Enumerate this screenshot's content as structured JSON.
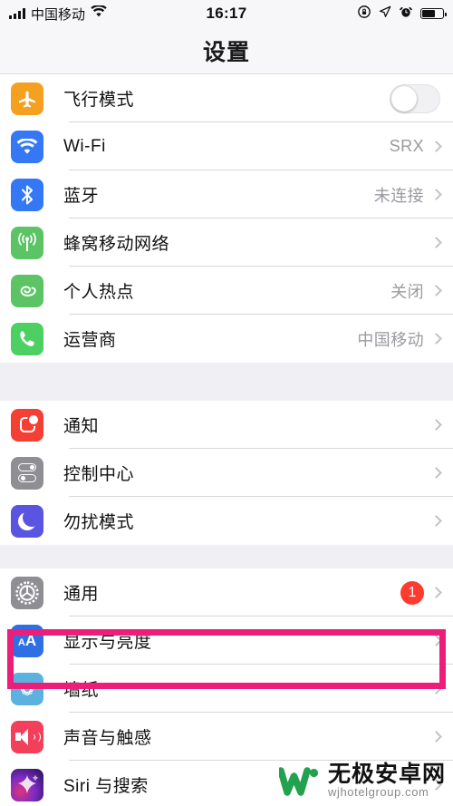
{
  "status_bar": {
    "signal_icon": "signal-bars-icon",
    "carrier": "中国移动",
    "wifi_icon": "wifi-icon",
    "time": "16:17",
    "rotation_lock_icon": "rotation-lock-icon",
    "location_icon": "location-arrow-icon",
    "alarm_icon": "alarm-clock-icon",
    "battery_icon": "battery-icon",
    "battery_level_percent": 62
  },
  "nav": {
    "title": "设置"
  },
  "groups": [
    {
      "rows": [
        {
          "icon": "airplane-icon",
          "icon_class": "ic-airplane",
          "label": "飞行模式",
          "value": "",
          "accessory": "toggle",
          "toggle_on": false
        },
        {
          "icon": "wifi-icon",
          "icon_class": "ic-wifi",
          "label": "Wi-Fi",
          "value": "SRX",
          "accessory": "chevron"
        },
        {
          "icon": "bluetooth-icon",
          "icon_class": "ic-bt",
          "label": "蓝牙",
          "value": "未连接",
          "accessory": "chevron"
        },
        {
          "icon": "cellular-antenna-icon",
          "icon_class": "ic-cell",
          "label": "蜂窝移动网络",
          "value": "",
          "accessory": "chevron"
        },
        {
          "icon": "personal-hotspot-icon",
          "icon_class": "ic-hotspot",
          "label": "个人热点",
          "value": "关闭",
          "accessory": "chevron"
        },
        {
          "icon": "phone-icon",
          "icon_class": "ic-phone",
          "label": "运营商",
          "value": "中国移动",
          "accessory": "chevron"
        }
      ]
    },
    {
      "rows": [
        {
          "icon": "notification-icon",
          "icon_class": "ic-notif",
          "label": "通知",
          "value": "",
          "accessory": "chevron"
        },
        {
          "icon": "control-center-icon",
          "icon_class": "ic-control",
          "label": "控制中心",
          "value": "",
          "accessory": "chevron"
        },
        {
          "icon": "do-not-disturb-moon-icon",
          "icon_class": "ic-dnd",
          "label": "勿扰模式",
          "value": "",
          "accessory": "chevron"
        }
      ]
    },
    {
      "rows": [
        {
          "icon": "gear-icon",
          "icon_class": "ic-general",
          "label": "通用",
          "value": "",
          "accessory": "chevron",
          "badge": "1"
        },
        {
          "icon": "display-brightness-aa-icon",
          "icon_class": "ic-display",
          "label": "显示与亮度",
          "value": "",
          "accessory": "chevron",
          "highlighted": true
        },
        {
          "icon": "wallpaper-flower-icon",
          "icon_class": "ic-wallpaper",
          "label": "墙纸",
          "value": "",
          "accessory": "chevron"
        },
        {
          "icon": "sound-speaker-icon",
          "icon_class": "ic-sound",
          "label": "声音与触感",
          "value": "",
          "accessory": "chevron"
        },
        {
          "icon": "siri-icon",
          "icon_class": "ic-siri",
          "label": "Siri 与搜索",
          "value": "",
          "accessory": "chevron"
        }
      ]
    }
  ],
  "highlight": {
    "target_label": "显示与亮度",
    "color": "#ED1E79"
  },
  "watermark": {
    "logo_icon": "w-logo-icon",
    "name": "无极安卓网",
    "url": "wjhotelgroup.com",
    "logo_color": "#22A24F"
  }
}
